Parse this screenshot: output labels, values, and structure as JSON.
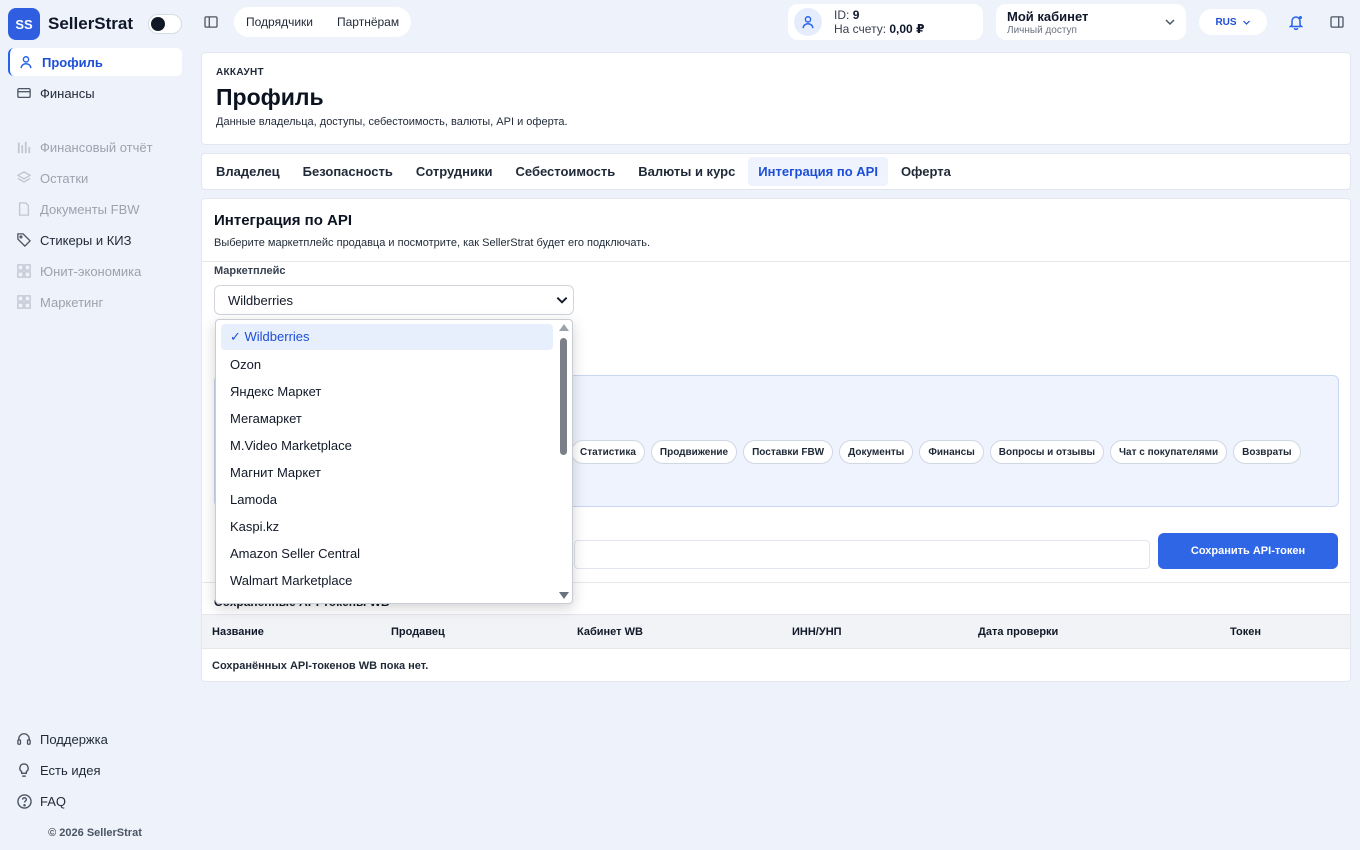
{
  "app": {
    "logo_text": "SS",
    "name": "SellerStrat"
  },
  "sidebar": {
    "items": [
      {
        "label": "Профиль",
        "icon": "user-icon",
        "state": "active"
      },
      {
        "label": "Финансы",
        "icon": "card-icon",
        "state": "normal"
      },
      {
        "label": "Финансовый отчёт",
        "icon": "bar-chart-icon",
        "state": "disabled"
      },
      {
        "label": "Остатки",
        "icon": "layers-icon",
        "state": "disabled"
      },
      {
        "label": "Документы FBW",
        "icon": "document-icon",
        "state": "disabled"
      },
      {
        "label": "Стикеры и КИЗ",
        "icon": "tag-icon",
        "state": "normal"
      },
      {
        "label": "Юнит-экономика",
        "icon": "grid-icon",
        "state": "disabled"
      },
      {
        "label": "Маркетинг",
        "icon": "grid-icon",
        "state": "disabled"
      }
    ],
    "footer_items": [
      {
        "label": "Поддержка",
        "icon": "headset-icon"
      },
      {
        "label": "Есть идея",
        "icon": "lightbulb-icon"
      },
      {
        "label": "FAQ",
        "icon": "help-icon"
      }
    ],
    "copyright": "© 2026 SellerStrat"
  },
  "topbar": {
    "links": [
      "Подрядчики",
      "Партнёрам"
    ],
    "account": {
      "id_label": "ID:",
      "id_value": "9",
      "balance_label": "На счету:",
      "balance_value": "0,00 ₽"
    },
    "cabinet": {
      "title": "Мой кабинет",
      "subtitle": "Личный доступ"
    },
    "language": "RUS"
  },
  "header": {
    "eyebrow": "АККАУНТ",
    "title": "Профиль",
    "subtitle": "Данные владельца, доступы, себестоимость, валюты, API и оферта."
  },
  "tabs": [
    {
      "label": "Владелец",
      "active": false
    },
    {
      "label": "Безопасность",
      "active": false
    },
    {
      "label": "Сотрудники",
      "active": false
    },
    {
      "label": "Себестоимость",
      "active": false
    },
    {
      "label": "Валюты и курс",
      "active": false
    },
    {
      "label": "Интеграция по API",
      "active": true
    },
    {
      "label": "Оферта",
      "active": false
    }
  ],
  "integration": {
    "title": "Интеграция по API",
    "subtitle": "Выберите маркетплейс продавца и посмотрите, как SellerStrat будет его подключать.",
    "marketplace_label": "Маркетплейс",
    "marketplace_value": "Wildberries",
    "permission_chips": [
      "Статистика",
      "Продвижение",
      "Поставки FBW",
      "Документы",
      "Финансы",
      "Вопросы и отзывы",
      "Чат с покупателями",
      "Возвраты"
    ],
    "save_button": "Сохранить API-токен",
    "saved_title": "Сохранённые API-токены WB",
    "table_columns": [
      "Название",
      "Продавец",
      "Кабинет WB",
      "ИНН/УНП",
      "Дата проверки",
      "Токен"
    ],
    "empty_text": "Сохранённых API-токенов WB пока нет."
  },
  "dropdown": {
    "options": [
      {
        "label": "✓ Wildberries",
        "selected": true
      },
      {
        "label": "Ozon",
        "selected": false
      },
      {
        "label": "Яндекс Маркет",
        "selected": false
      },
      {
        "label": "Мегамаркет",
        "selected": false
      },
      {
        "label": "M.Video Marketplace",
        "selected": false
      },
      {
        "label": "Магнит Маркет",
        "selected": false
      },
      {
        "label": "Lamoda",
        "selected": false
      },
      {
        "label": "Kaspi.kz",
        "selected": false
      },
      {
        "label": "Amazon Seller Central",
        "selected": false
      },
      {
        "label": "Walmart Marketplace",
        "selected": false
      }
    ]
  },
  "colors": {
    "accent": "#2f66e6",
    "active_text": "#1d4ed8",
    "background": "#eef2fa"
  }
}
